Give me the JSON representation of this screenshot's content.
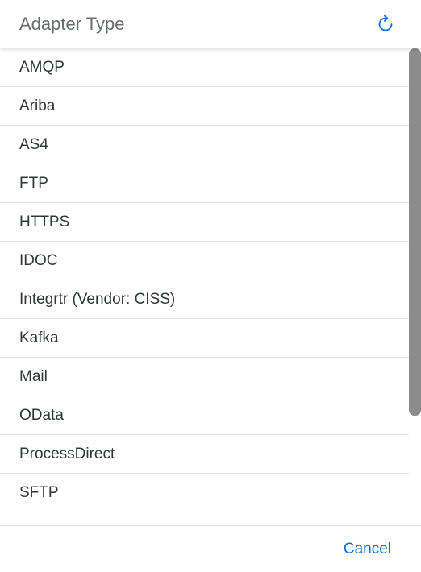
{
  "dialog": {
    "title": "Adapter Type",
    "refresh_icon": "refresh-icon",
    "accent_color": "#0a6ed1",
    "cancel_label": "Cancel"
  },
  "list": {
    "items": [
      {
        "label": "AMQP"
      },
      {
        "label": "Ariba"
      },
      {
        "label": "AS4"
      },
      {
        "label": "FTP"
      },
      {
        "label": "HTTPS"
      },
      {
        "label": "IDOC"
      },
      {
        "label": "Integrtr (Vendor: CISS)"
      },
      {
        "label": "Kafka"
      },
      {
        "label": "Mail"
      },
      {
        "label": "OData"
      },
      {
        "label": "ProcessDirect"
      },
      {
        "label": "SFTP"
      }
    ]
  }
}
